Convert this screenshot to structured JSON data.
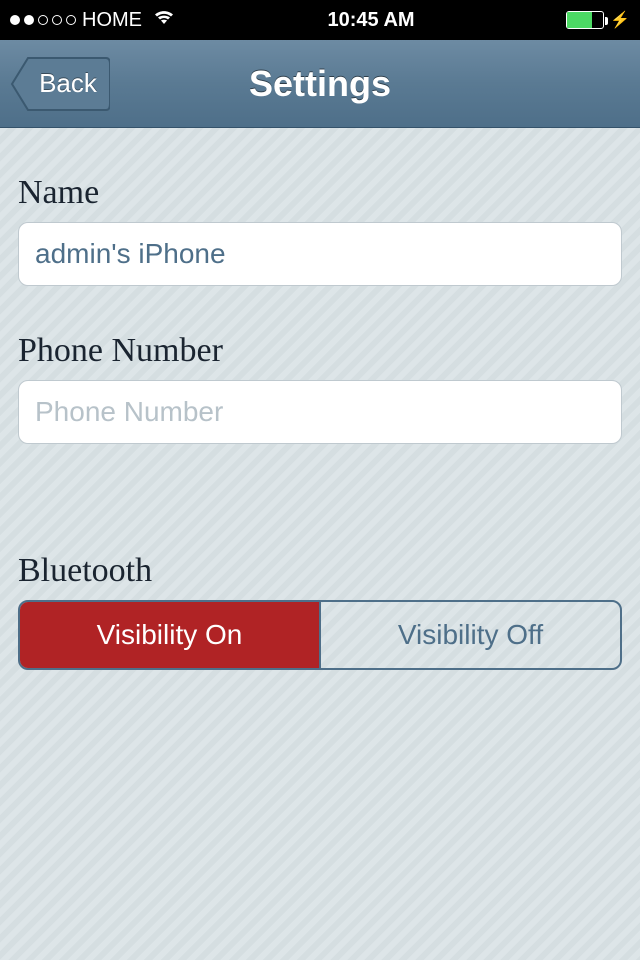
{
  "status": {
    "carrier": "HOME",
    "time": "10:45 AM"
  },
  "nav": {
    "back_label": "Back",
    "title": "Settings"
  },
  "form": {
    "name_label": "Name",
    "name_value": "admin's iPhone",
    "phone_label": "Phone Number",
    "phone_placeholder": "Phone Number",
    "phone_value": ""
  },
  "bluetooth": {
    "label": "Bluetooth",
    "on_label": "Visibility On",
    "off_label": "Visibility Off",
    "active": "on"
  }
}
